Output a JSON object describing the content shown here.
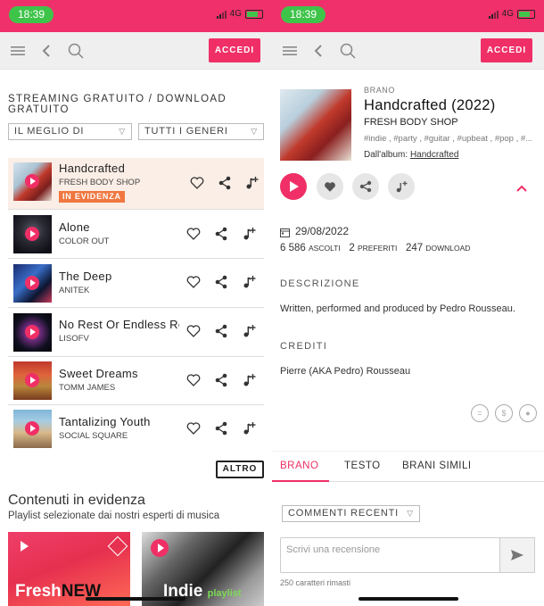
{
  "status": {
    "time": "18:39",
    "network": "4G"
  },
  "left": {
    "header": {
      "login_label": "ACCEDI"
    },
    "section_title": "STREAMING GRATUITO / DOWNLOAD GRATUITO",
    "filter_sort": "IL MEGLIO DI",
    "filter_genre": "TUTTI I GENERI",
    "tracks": [
      {
        "title": "Handcrafted",
        "artist": "FRESH BODY SHOP",
        "badge": "IN EVIDENZA"
      },
      {
        "title": "Alone",
        "artist": "COLOR OUT"
      },
      {
        "title": "The Deep",
        "artist": "ANITEK"
      },
      {
        "title": "No Rest Or Endless Re",
        "artist": "LISOFV"
      },
      {
        "title": "Sweet Dreams",
        "artist": "TOMM JAMES"
      },
      {
        "title": "Tantalizing Youth",
        "artist": "SOCIAL SQUARE"
      }
    ],
    "more_label": "ALTRO",
    "featured_title": "Contenuti in evidenza",
    "featured_subtitle": "Playlist selezionate dai nostri esperti di musica",
    "playlist_1": {
      "word1": "Fresh",
      "word2": "NEW"
    },
    "playlist_2": {
      "word1": "Indie",
      "word2": "playlist"
    }
  },
  "right": {
    "header": {
      "login_label": "ACCEDI"
    },
    "kind_label": "BRANO",
    "title": "Handcrafted (2022)",
    "artist": "FRESH BODY SHOP",
    "tags": "#indie , #party , #guitar , #upbeat , #pop , #...",
    "album_prefix": "Dall'album:",
    "album_name": "Handcrafted",
    "date": "29/08/2022",
    "plays_count": "6 586",
    "plays_label": "ASCOLTI",
    "favorites_count": "2",
    "favorites_label": "PREFERITI",
    "downloads_count": "247",
    "downloads_label": "DOWNLOAD",
    "description_heading": "DESCRIZIONE",
    "description": "Written, performed and produced by Pedro Rousseau.",
    "credits_heading": "CREDITI",
    "credits": "Pierre (AKA Pedro) Rousseau",
    "tabs": [
      "BRANO",
      "TESTO",
      "BRANI SIMILI"
    ],
    "comments_filter": "COMMENTI RECENTI",
    "review_placeholder": "Scrivi una recensione",
    "chars_left": "250 caratteri rimasti"
  },
  "colors": {
    "accent": "#ef2f66",
    "status_bar": "#f0306b",
    "badge": "#f07840"
  }
}
